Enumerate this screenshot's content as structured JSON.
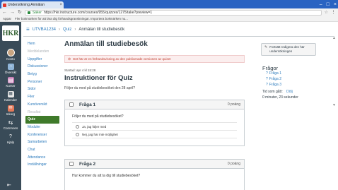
{
  "browser": {
    "tab_title": "Undersökning:Anmälan",
    "tab_close": "×",
    "window_controls": [
      "–",
      "□",
      "×"
    ],
    "secure_label": "Säker",
    "url": "https://hkr.instructure.com/courses/955/quizzes/1275/take?preview=1",
    "bookmarks": [
      "Appar",
      "Fler bokmärken för att lära dig förhandsgranskningar. Importera bokmärken nu..."
    ]
  },
  "global_nav": {
    "logo": "HKR",
    "items": [
      {
        "label": "Konto",
        "icon": "avatar-icon"
      },
      {
        "label": "Översikt",
        "icon": "dashboard-icon"
      },
      {
        "label": "Kurser",
        "icon": "courses-icon"
      },
      {
        "label": "Kalender",
        "icon": "calendar-icon"
      },
      {
        "label": "Inkorg",
        "icon": "inbox-icon"
      },
      {
        "label": "Commons",
        "icon": "commons-icon"
      },
      {
        "label": "Hjälp",
        "icon": "help-icon"
      }
    ],
    "collapse_glyph": "⇤"
  },
  "breadcrumb": {
    "course": "UTVBA1234",
    "section": "Quiz",
    "current": "Anmälan till studiebesök"
  },
  "course_nav": [
    {
      "label": "Hem",
      "state": "normal"
    },
    {
      "label": "Meddelanden",
      "state": "faded"
    },
    {
      "label": "Uppgifter",
      "state": "normal"
    },
    {
      "label": "Diskussioner",
      "state": "normal"
    },
    {
      "label": "Betyg",
      "state": "normal"
    },
    {
      "label": "Personer",
      "state": "normal"
    },
    {
      "label": "Sidor",
      "state": "normal"
    },
    {
      "label": "Filer",
      "state": "normal"
    },
    {
      "label": "Kursöversikt",
      "state": "normal"
    },
    {
      "label": "Resultat",
      "state": "faded"
    },
    {
      "label": "Quiz",
      "state": "active"
    },
    {
      "label": "Moduler",
      "state": "normal"
    },
    {
      "label": "Konferenser",
      "state": "normal"
    },
    {
      "label": "Samarbeten",
      "state": "normal"
    },
    {
      "label": "Chat",
      "state": "normal"
    },
    {
      "label": "Attendance",
      "state": "normal"
    },
    {
      "label": "Inställningar",
      "state": "normal"
    }
  ],
  "main": {
    "title": "Anmälan till studiebesök",
    "warning": "Det här är en förhandsvisning av den publicerade versionen av quizet",
    "started": "Startad: apr 4 kl 15:28",
    "instructions_title": "Instruktioner för Quiz",
    "instructions_text": "Följer du med på studiebesöket den 28 april?",
    "questions": [
      {
        "title": "Fråga 1",
        "points": "0 poäng",
        "text": "Följer du med på studiebesöket?",
        "answers": [
          "Ja, jag följer med",
          "Nej, jag har inte möjlighet"
        ]
      },
      {
        "title": "Fråga 2",
        "points": "0 poäng",
        "text": "Hur kommer du att ta dig till studiebesöket?",
        "answers": []
      }
    ]
  },
  "sidebar": {
    "edit_button": "Fortsätt redigera den här undersökningen",
    "questions_heading": "Frågor",
    "question_links": [
      "Fråga 1",
      "Fråga 2",
      "Fråga 3"
    ],
    "time_label": "Tid som gått:",
    "time_toggle": "Dölj",
    "time_value": "0 minuter, 23 sekunder"
  },
  "colors": {
    "global_nav_bg": "#394b58",
    "link": "#2b7abc",
    "active_nav": "#3f7a2a",
    "warning": "#c23c2d"
  }
}
